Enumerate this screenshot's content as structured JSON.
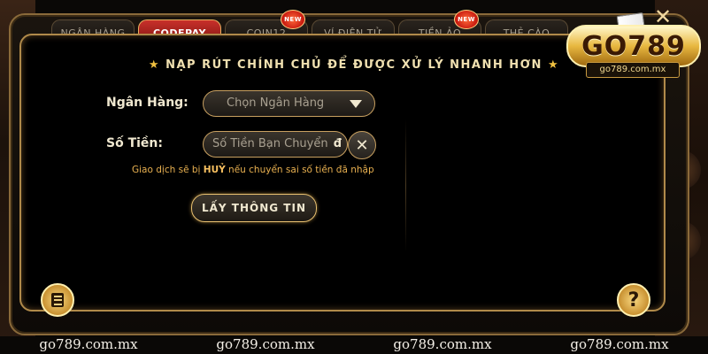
{
  "tabs": [
    {
      "label": "NGÂN HÀNG",
      "active": false,
      "new": false
    },
    {
      "label": "CODEPAY",
      "active": true,
      "new": false
    },
    {
      "label": "COIN12",
      "active": false,
      "new": true
    },
    {
      "label": "VÍ ĐIỆN TỬ",
      "active": false,
      "new": false
    },
    {
      "label": "TIỀN ẢO",
      "active": false,
      "new": true
    },
    {
      "label": "THẺ CÀO",
      "active": false,
      "new": false
    }
  ],
  "badge_text": "NEW",
  "logo": {
    "main": "GO789",
    "sub": "go789.com.mx"
  },
  "header": {
    "title": "NẠP RÚT CHÍNH CHỦ ĐỂ ĐƯỢC XỬ LÝ NHANH HƠN",
    "star": "★"
  },
  "form": {
    "bank_label": "Ngân Hàng:",
    "bank_placeholder": "Chọn Ngân Hàng",
    "amount_label": "Số Tiền:",
    "amount_placeholder": "Số Tiền Bạn Chuyển",
    "amount_suffix": "đ",
    "clear": "✕",
    "note_before": "Giao dịch sẽ bị ",
    "note_bold": "HUỶ",
    "note_after": " nếu chuyển sai số tiền đã nhập",
    "submit": "LẤY THÔNG TIN"
  },
  "close": "✕",
  "help": "?",
  "watermarks": [
    "go789.com.mx",
    "go789.com.mx",
    "go789.com.mx",
    "go789.com.mx"
  ],
  "colors": {
    "accent_gold": "#c8a060",
    "active_tab": "#c8302a",
    "note": "#e8b050"
  }
}
